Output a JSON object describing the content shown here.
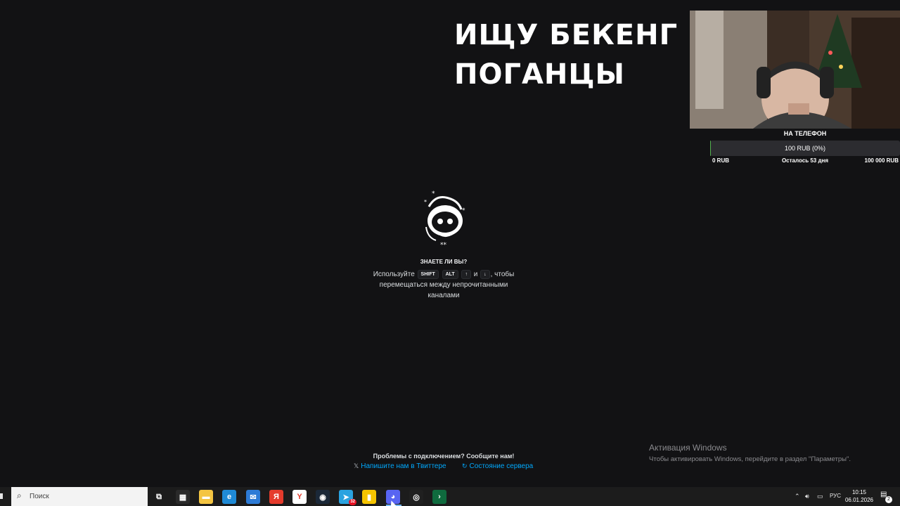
{
  "overlay": {
    "title_line1": "ИЩУ БЕКЕНГ",
    "title_line2": "ПОГАНЦЫ"
  },
  "donation_goal": {
    "title": "НА ТЕЛЕФОН",
    "progress_text": "100 RUB (0%)",
    "progress_fraction": 0.001,
    "min_label": "0 RUB",
    "days_left": "Осталось 53 дня",
    "max_label": "100 000 RUB",
    "fill_color": "#53b14f"
  },
  "loader": {
    "heading": "Знаете ли вы?",
    "tip_prefix": "Используйте",
    "key_shift": "SHIFT",
    "key_alt": "ALT",
    "key_up": "↑",
    "tip_and": "и",
    "key_down": "↓",
    "tip_suffix": ", чтобы перемещаться между непрочитанными каналами",
    "logo_icon": "discord-wumpus-winter-icon"
  },
  "help": {
    "connection_problem": "Проблемы с подключением? Сообщите нам!",
    "twitter_link": "Напишите нам в Твиттере",
    "status_link": "Состояние сервера",
    "link_color": "#00a8fc"
  },
  "windows_activation": {
    "title": "Активация Windows",
    "subtitle": "Чтобы активировать Windows, перейдите в раздел \"Параметры\"."
  },
  "taskbar": {
    "search_placeholder": "Поиск",
    "apps": [
      {
        "name": "task-view-icon",
        "label": "⧉",
        "color": "#1c1c1c"
      },
      {
        "name": "store-icon",
        "label": "▦",
        "color": "#2a2a2a"
      },
      {
        "name": "file-explorer-icon",
        "label": "▬",
        "color": "#f4c542"
      },
      {
        "name": "edge-icon",
        "label": "e",
        "color": "#1f8ad6"
      },
      {
        "name": "mail-icon",
        "label": "✉",
        "color": "#2d7bd6"
      },
      {
        "name": "yandex-icon",
        "label": "Я",
        "color": "#e53b2c"
      },
      {
        "name": "yandex-browser-icon",
        "label": "Y",
        "color": "#ffffff"
      },
      {
        "name": "steam-icon",
        "label": "◉",
        "color": "#1b2838"
      },
      {
        "name": "telegram-icon",
        "label": "➤",
        "color": "#2aa3e0"
      },
      {
        "name": "media-app-icon",
        "label": "▮",
        "color": "#f5c400"
      },
      {
        "name": "discord-icon",
        "label": "◕",
        "color": "#5865f2"
      },
      {
        "name": "obs-icon",
        "label": "◎",
        "color": "#202020"
      },
      {
        "name": "terminal-app-icon",
        "label": "›",
        "color": "#0f6b3e"
      }
    ],
    "telegram_badge": "32",
    "tray_language": "РУС",
    "time": "10:15",
    "date": "06.01.2026",
    "notification_count": "2"
  }
}
